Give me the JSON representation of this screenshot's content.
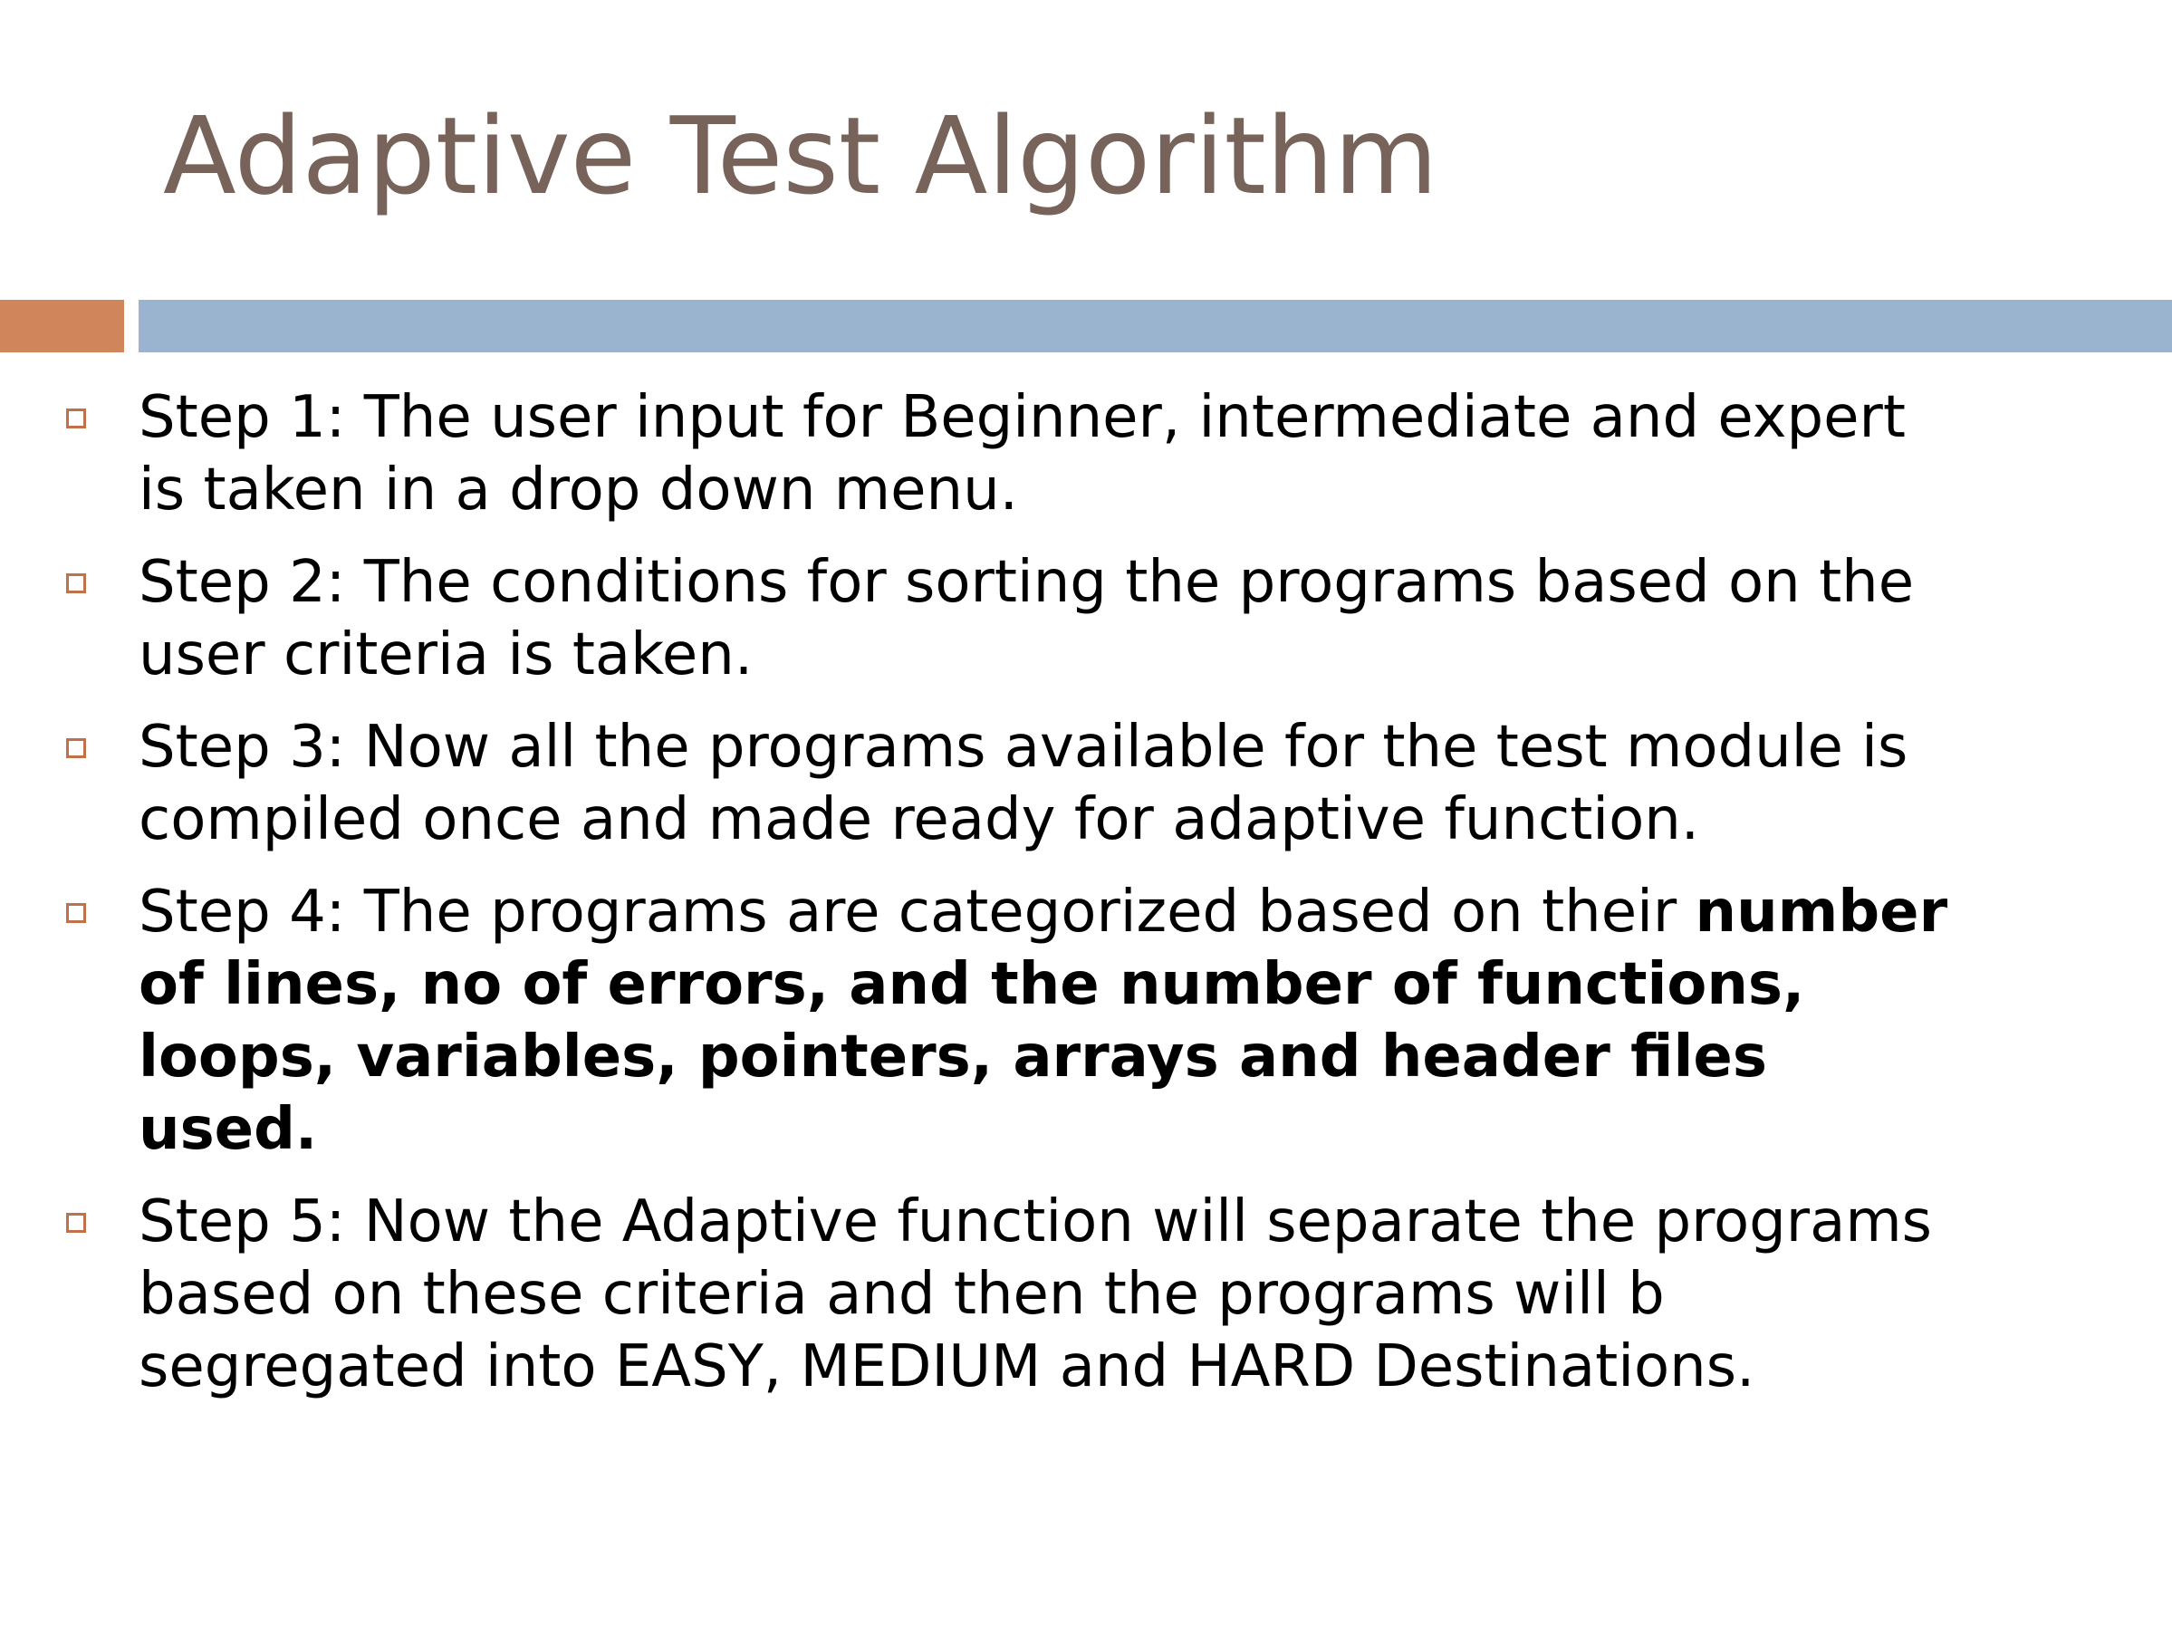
{
  "slide": {
    "title": "Adaptive Test Algorithm"
  },
  "colors": {
    "title": "#776359",
    "accent_orange": "#D0865A",
    "accent_blue": "#9AB4D0",
    "bullet_marker": "#C0714A",
    "body_text": "#000000"
  },
  "bullets": [
    {
      "text": " Step 1: The user input for Beginner, intermediate and expert is taken in a drop down menu."
    },
    {
      "text": "Step 2: The conditions for sorting the programs based on the user criteria is taken."
    },
    {
      "text": "Step 3: Now all the programs available for the test module is compiled once and made ready for adaptive function."
    },
    {
      "text": "Step 4: The programs are categorized based on their ",
      "bold": "number of lines, no of errors, and the number of functions, loops, variables, pointers, arrays and header files used."
    },
    {
      "text": "Step 5: Now the Adaptive function will separate the programs based on these criteria and then the programs will b segregated into EASY, MEDIUM and HARD Destinations."
    }
  ]
}
